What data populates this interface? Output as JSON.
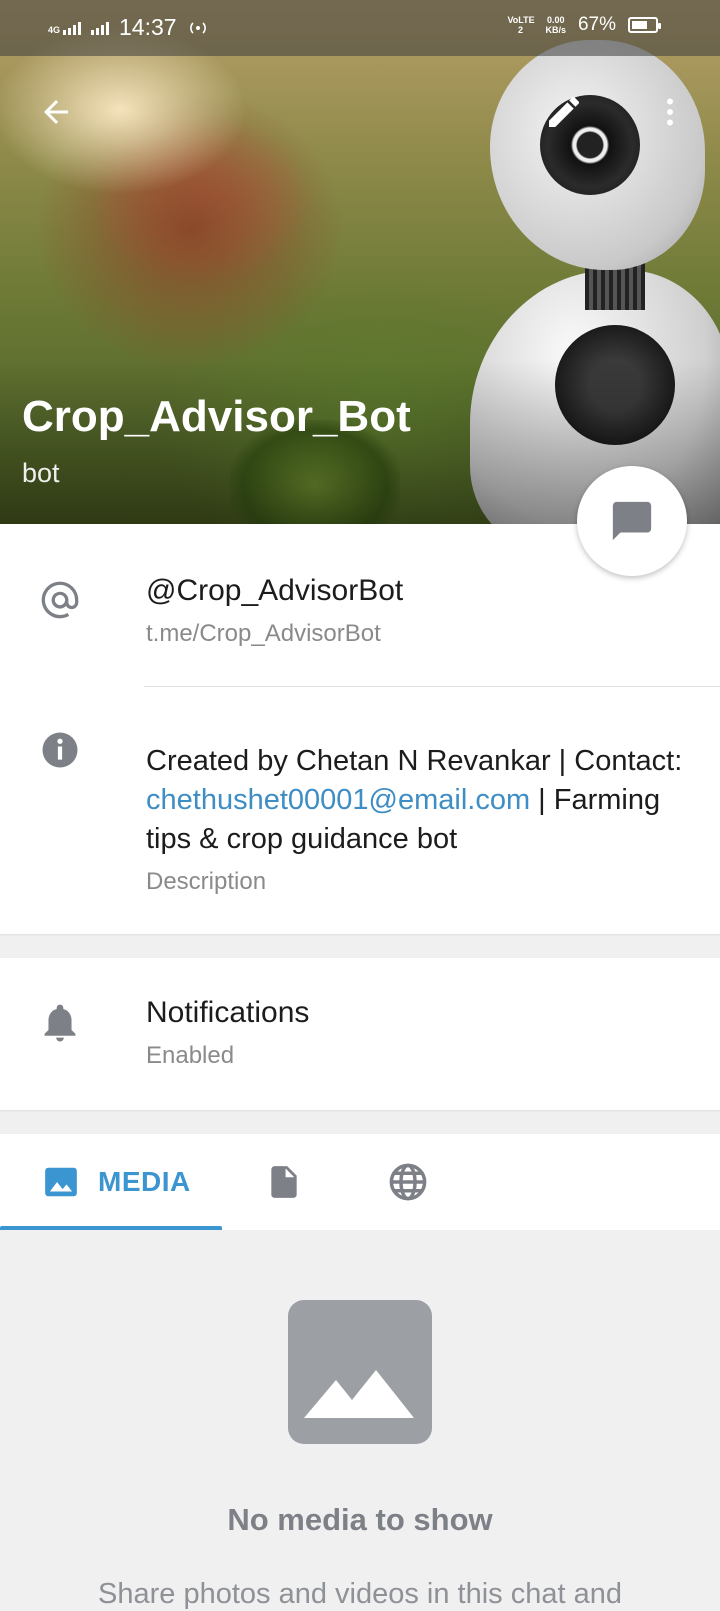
{
  "status_bar": {
    "network_type": "4G",
    "time": "14:37",
    "volte_label": "VoLTE 2",
    "speed_value": "0.00",
    "speed_unit": "KB/s",
    "battery": "67%",
    "battery_level": 0.67
  },
  "header": {
    "title": "Crop_Advisor_Bot",
    "subtitle": "bot"
  },
  "info": {
    "username": "@Crop_AdvisorBot",
    "link": "t.me/Crop_AdvisorBot",
    "description_before": "Created by Chetan N Revankar | Contact: ",
    "description_email": "chethushet00001@email.com",
    "description_after": " | Farming tips & crop guidance bot",
    "description_label": "Description"
  },
  "notifications": {
    "title": "Notifications",
    "status": "Enabled"
  },
  "tabs": {
    "media_label": "MEDIA",
    "icons": [
      "image-icon",
      "file-icon",
      "globe-icon"
    ]
  },
  "empty_state": {
    "title": "No media to show",
    "text": "Share photos and videos in this chat and"
  },
  "colors": {
    "accent": "#3a95d0",
    "link": "#3f8dc5",
    "icon_gray": "#7d8187"
  }
}
